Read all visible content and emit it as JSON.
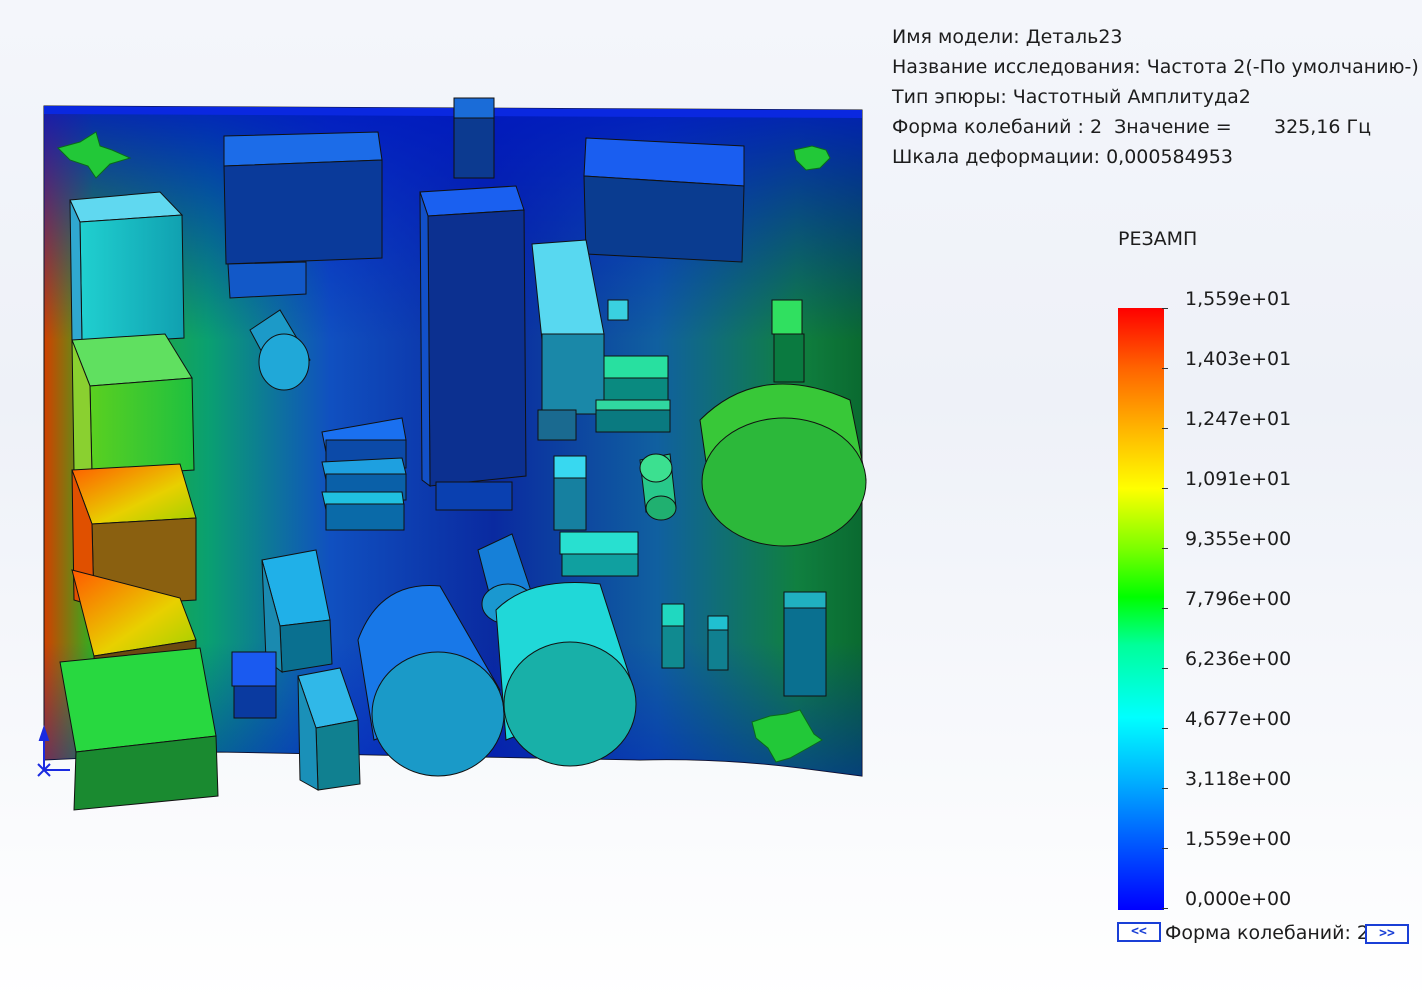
{
  "info": {
    "model_name": "Имя модели: Деталь23",
    "study_name": "Название исследования: Частота 2(-По умолчанию-)",
    "plot_type": "Тип эпюры: Частотный Амплитуда2",
    "mode_shape": "Форма колебаний : 2  Значение =       325,16 Гц",
    "deformation_scale": "Шкала деформации: 0,000584953"
  },
  "legend": {
    "title": "РЕЗАМП",
    "labels": [
      "1,559e+01",
      "1,403e+01",
      "1,247e+01",
      "1,091e+01",
      "9,355e+00",
      "7,796e+00",
      "6,236e+00",
      "4,677e+00",
      "3,118e+00",
      "1,559e+00",
      "0,000e+00"
    ],
    "colors": {
      "max": "#ff0000",
      "mid": "#00ff00",
      "min": "#0000ff"
    }
  },
  "navigation": {
    "prev_label": "<<",
    "mode_label": "Форма колебаний: 2",
    "next_label": ">>"
  },
  "icons": [
    "fixture-icon",
    "coordinate-triad-icon"
  ]
}
